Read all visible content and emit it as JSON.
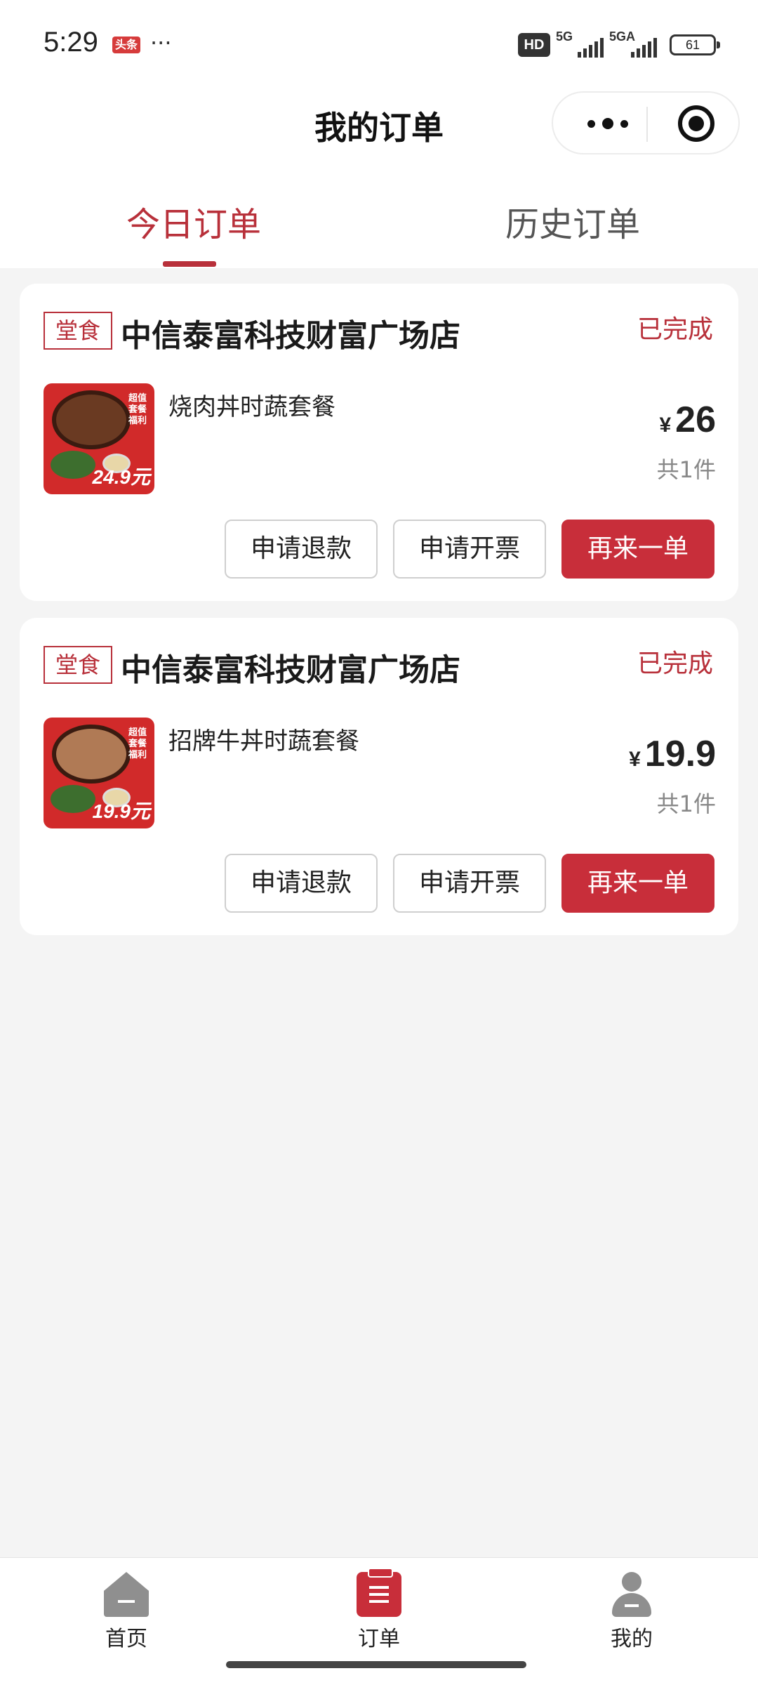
{
  "status_bar": {
    "time": "5:29",
    "news_badge": "头条",
    "more": "···",
    "hd": "HD",
    "net1": "5G",
    "net2": "5GA",
    "battery": "61"
  },
  "header": {
    "title": "我的订单"
  },
  "tabs": [
    {
      "label": "今日订单",
      "active": true
    },
    {
      "label": "历史订单",
      "active": false
    }
  ],
  "orders": [
    {
      "type_badge": "堂食",
      "store": "中信泰富科技财富广场店",
      "status": "已完成",
      "dish": "烧肉丼时蔬套餐",
      "currency": "¥",
      "price": "26",
      "quantity": "共1件",
      "thumb_welfare": "超值套餐 福利",
      "thumb_price": "24.9元",
      "actions": {
        "refund": "申请退款",
        "invoice": "申请开票",
        "reorder": "再来一单"
      }
    },
    {
      "type_badge": "堂食",
      "store": "中信泰富科技财富广场店",
      "status": "已完成",
      "dish": "招牌牛丼时蔬套餐",
      "currency": "¥",
      "price": "19.9",
      "quantity": "共1件",
      "thumb_welfare": "超值套餐 福利",
      "thumb_price": "19.9元",
      "actions": {
        "refund": "申请退款",
        "invoice": "申请开票",
        "reorder": "再来一单"
      }
    }
  ],
  "bottom_nav": [
    {
      "label": "首页",
      "icon": "home-icon",
      "active": false
    },
    {
      "label": "订单",
      "icon": "orders-icon",
      "active": true
    },
    {
      "label": "我的",
      "icon": "profile-icon",
      "active": false
    }
  ],
  "colors": {
    "accent": "#c82e3a",
    "background": "#f4f4f4"
  }
}
